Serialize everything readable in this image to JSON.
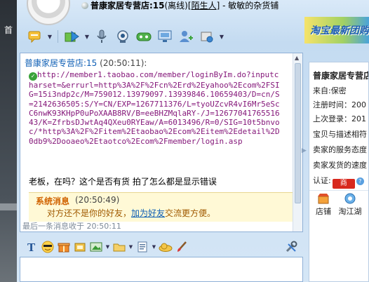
{
  "desktop": {
    "glyph": "首"
  },
  "header": {
    "shop": "普康家居专营店:15",
    "status": "(离线)",
    "stranger": "陌生人",
    "separator": " - ",
    "nickname": "敏敏的杂货铺"
  },
  "ad": {
    "text": "淘宝最新团购"
  },
  "toolbar": {
    "items": [
      "chat-icon",
      "file-transfer-icon",
      "voice-icon",
      "video-icon",
      "game-icon",
      "screen-share-icon",
      "add-friend-icon",
      "settings-icon"
    ]
  },
  "history": {
    "sender": "普康家居专营店:15",
    "time": "(20:50:11):",
    "link_text": "http://member1.taobao.com/member/loginByIm.do?inputcharset=&errurl=http%3A%2F%2Fcn%2Erd%2Eyahoo%2Ecom%2FSIG=15i3ndp2c/M=759012.13979097.13939846.10659403/D=cn/S=2142636505:S/Y=CN/EXP=1267711376/L=tyoUZcvR4vI6Mr5eScC6nwK93KHpP0uPoXAAB8RV/B=eeBHZMqlaRY-/J=1267704176551643/K=ZfrbsDJwtAq4QXeu0RYEaw/A=6013496/R=0/SIG=10t5bnvoc/*http%3A%2F%2Fitem%2Etaobao%2Ecom%2Eitem%2Edetail%2D0db9%2Dooaeo%2Etaotco%2Ecom%2Fmember/login.asp",
    "message": "老板，在吗？这个是否有货 拍了怎么都是显示错误",
    "system": {
      "title": "系统消息",
      "time": "(20:50:49)",
      "before": "对方还不是你的好友，",
      "link": "加为好友",
      "after": "交流更方便。"
    },
    "last_received": "最后一条消息收于 20:50:11"
  },
  "input_toolbar": {
    "items": [
      "font-icon",
      "emoticon-icon",
      "gift-icon",
      "shake-icon",
      "image-icon",
      "folder-icon",
      "note-icon",
      "cloud-icon",
      "brush-icon",
      "tools-icon"
    ]
  },
  "side": {
    "shop": "普康家居专营店",
    "from": "来自:保密",
    "registered": "注册时间：200",
    "last_login": "上次登录：201",
    "match": "宝贝与描述相符",
    "service": "卖家的服务态度",
    "delivery": "卖家发货的速度",
    "cert_label": "认证:",
    "cert_badge": "商",
    "shortcut_store": "店铺",
    "shortcut_jianghu": "淘江湖"
  },
  "colors": {
    "link": "#85187a",
    "accent_blue": "#0f5fb5",
    "system_orange": "#d06200"
  }
}
